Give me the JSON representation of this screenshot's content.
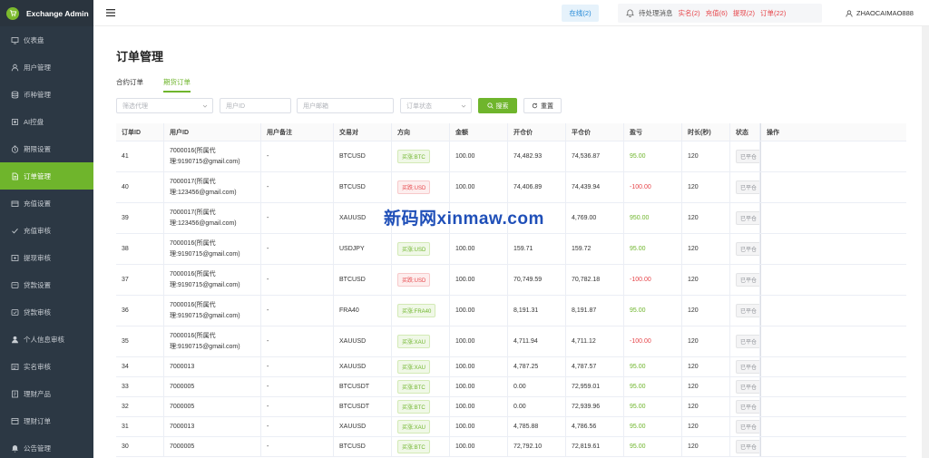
{
  "brand": {
    "name": "Exchange Admin"
  },
  "sidebar": {
    "items": [
      {
        "label": "仪表盘",
        "icon": "dashboard-icon",
        "active": false
      },
      {
        "label": "用户管理",
        "icon": "user-icon",
        "active": false
      },
      {
        "label": "币种管理",
        "icon": "database-icon",
        "active": false
      },
      {
        "label": "AI控盘",
        "icon": "ai-icon",
        "active": false
      },
      {
        "label": "期限设置",
        "icon": "timer-icon",
        "active": false
      },
      {
        "label": "订单管理",
        "icon": "document-icon",
        "active": true
      },
      {
        "label": "充值设置",
        "icon": "wallet-icon",
        "active": false
      },
      {
        "label": "充值审核",
        "icon": "check-icon",
        "active": false
      },
      {
        "label": "提现审核",
        "icon": "withdraw-icon",
        "active": false
      },
      {
        "label": "贷款设置",
        "icon": "loan-icon",
        "active": false
      },
      {
        "label": "贷款审核",
        "icon": "audit-icon",
        "active": false
      },
      {
        "label": "个人信息审核",
        "icon": "person-icon",
        "active": false
      },
      {
        "label": "实名审核",
        "icon": "id-card-icon",
        "active": false
      },
      {
        "label": "理财产品",
        "icon": "product-icon",
        "active": false
      },
      {
        "label": "理财订单",
        "icon": "order-icon",
        "active": false
      },
      {
        "label": "公告管理",
        "icon": "bell-icon",
        "active": false
      }
    ]
  },
  "header": {
    "online": "在线(2)",
    "pending_label": "待处理消息",
    "badges": [
      "实名(2)",
      "充值(6)",
      "提现(2)",
      "订单(22)"
    ],
    "username": "ZHAOCAIMAO888"
  },
  "page": {
    "title": "订单管理",
    "tabs": [
      {
        "label": "合约订单",
        "active": false
      },
      {
        "label": "期货订单",
        "active": true
      }
    ]
  },
  "filters": {
    "agent_placeholder": "筛选代理",
    "user_id_placeholder": "用户ID",
    "email_placeholder": "用户邮箱",
    "status_placeholder": "订单状态",
    "search_label": "搜索",
    "reset_label": "重置"
  },
  "table": {
    "columns": [
      "订单ID",
      "用户ID",
      "用户备注",
      "交易对",
      "方向",
      "金额",
      "开仓价",
      "平仓价",
      "盈亏",
      "时长(秒)",
      "状态",
      "操作"
    ],
    "rows": [
      {
        "id": "41",
        "user_line1": "7000016(所属代",
        "user_line2": "理:9190715@gmail.com)",
        "remark": "-",
        "pair": "BTCUSD",
        "direction": "买涨:BTC",
        "dir_type": "buy",
        "amount": "100.00",
        "open": "74,482.93",
        "close": "74,536.87",
        "pnl": "95.00",
        "pnl_type": "pos",
        "duration": "120",
        "status": "已平仓"
      },
      {
        "id": "40",
        "user_line1": "7000017(所属代",
        "user_line2": "理:123456@gmail.com)",
        "remark": "-",
        "pair": "BTCUSD",
        "direction": "买跌:USD",
        "dir_type": "sell",
        "amount": "100.00",
        "open": "74,406.89",
        "close": "74,439.94",
        "pnl": "-100.00",
        "pnl_type": "neg",
        "duration": "120",
        "status": "已平仓"
      },
      {
        "id": "39",
        "user_line1": "7000017(所属代",
        "user_line2": "理:123456@gmail.com)",
        "remark": "-",
        "pair": "XAUUSD",
        "direction": "",
        "dir_type": "buy",
        "amount": "",
        "open": "",
        "close": "4,769.00",
        "pnl": "950.00",
        "pnl_type": "pos",
        "duration": "120",
        "status": "已平仓"
      },
      {
        "id": "38",
        "user_line1": "7000016(所属代",
        "user_line2": "理:9190715@gmail.com)",
        "remark": "-",
        "pair": "USDJPY",
        "direction": "买涨:USD",
        "dir_type": "buy",
        "amount": "100.00",
        "open": "159.71",
        "close": "159.72",
        "pnl": "95.00",
        "pnl_type": "pos",
        "duration": "120",
        "status": "已平仓"
      },
      {
        "id": "37",
        "user_line1": "7000016(所属代",
        "user_line2": "理:9190715@gmail.com)",
        "remark": "-",
        "pair": "BTCUSD",
        "direction": "买跌:USD",
        "dir_type": "sell",
        "amount": "100.00",
        "open": "70,749.59",
        "close": "70,782.18",
        "pnl": "-100.00",
        "pnl_type": "neg",
        "duration": "120",
        "status": "已平仓"
      },
      {
        "id": "36",
        "user_line1": "7000016(所属代",
        "user_line2": "理:9190715@gmail.com)",
        "remark": "-",
        "pair": "FRA40",
        "direction": "买涨:FRA40",
        "dir_type": "buy",
        "amount": "100.00",
        "open": "8,191.31",
        "close": "8,191.87",
        "pnl": "95.00",
        "pnl_type": "pos",
        "duration": "120",
        "status": "已平仓"
      },
      {
        "id": "35",
        "user_line1": "7000016(所属代",
        "user_line2": "理:9190715@gmail.com)",
        "remark": "-",
        "pair": "XAUUSD",
        "direction": "买涨:XAU",
        "dir_type": "buy",
        "amount": "100.00",
        "open": "4,711.94",
        "close": "4,711.12",
        "pnl": "-100.00",
        "pnl_type": "neg",
        "duration": "120",
        "status": "已平仓"
      },
      {
        "id": "34",
        "user_line1": "7000013",
        "user_line2": "",
        "remark": "-",
        "pair": "XAUUSD",
        "direction": "买涨:XAU",
        "dir_type": "buy",
        "amount": "100.00",
        "open": "4,787.25",
        "close": "4,787.57",
        "pnl": "95.00",
        "pnl_type": "pos",
        "duration": "120",
        "status": "已平仓"
      },
      {
        "id": "33",
        "user_line1": "7000005",
        "user_line2": "",
        "remark": "-",
        "pair": "BTCUSDT",
        "direction": "买涨:BTC",
        "dir_type": "buy",
        "amount": "100.00",
        "open": "0.00",
        "close": "72,959.01",
        "pnl": "95.00",
        "pnl_type": "pos",
        "duration": "120",
        "status": "已平仓"
      },
      {
        "id": "32",
        "user_line1": "7000005",
        "user_line2": "",
        "remark": "-",
        "pair": "BTCUSDT",
        "direction": "买涨:BTC",
        "dir_type": "buy",
        "amount": "100.00",
        "open": "0.00",
        "close": "72,939.96",
        "pnl": "95.00",
        "pnl_type": "pos",
        "duration": "120",
        "status": "已平仓"
      },
      {
        "id": "31",
        "user_line1": "7000013",
        "user_line2": "",
        "remark": "-",
        "pair": "XAUUSD",
        "direction": "买涨:XAU",
        "dir_type": "buy",
        "amount": "100.00",
        "open": "4,785.88",
        "close": "4,786.56",
        "pnl": "95.00",
        "pnl_type": "pos",
        "duration": "120",
        "status": "已平仓"
      },
      {
        "id": "30",
        "user_line1": "7000005",
        "user_line2": "",
        "remark": "-",
        "pair": "BTCUSD",
        "direction": "买涨:BTC",
        "dir_type": "buy",
        "amount": "100.00",
        "open": "72,792.10",
        "close": "72,819.61",
        "pnl": "95.00",
        "pnl_type": "pos",
        "duration": "120",
        "status": "已平仓"
      }
    ]
  },
  "watermark": "新码网xinmaw.com",
  "colors": {
    "accent": "#6fb52c",
    "sidebar": "#2c3844",
    "danger": "#e6454a",
    "info": "#1e86d6"
  }
}
